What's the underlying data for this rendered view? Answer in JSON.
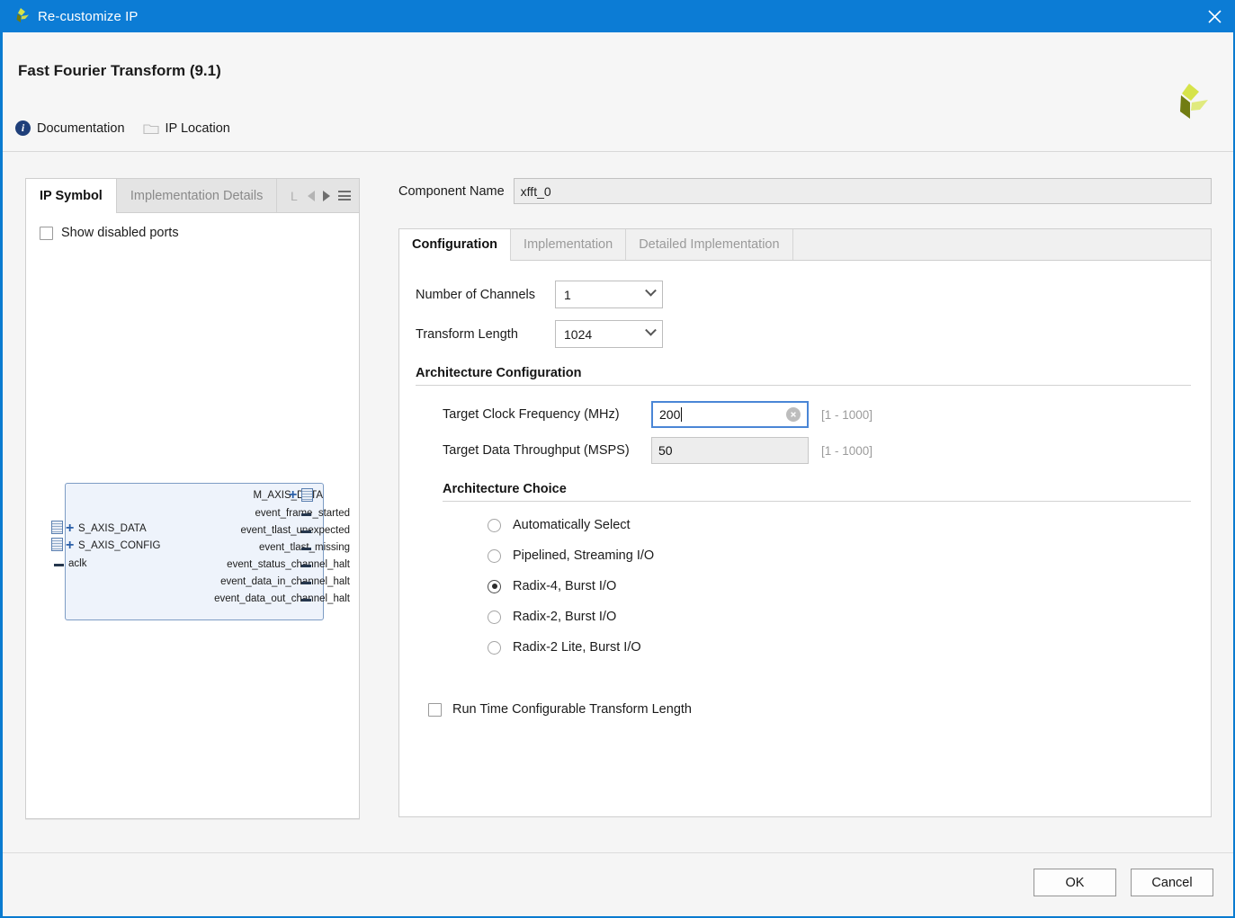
{
  "window": {
    "title": "Re-customize IP",
    "logo_icon": "xilinx-logo-icon",
    "close_icon": "close-icon",
    "accent_color": "#0c7cd5"
  },
  "header": {
    "title": "Fast Fourier Transform (9.1)",
    "brand_logo_icon": "xilinx-logo-icon",
    "links": [
      {
        "label": "Documentation",
        "icon": "info-icon"
      },
      {
        "label": "IP Location",
        "icon": "folder-icon"
      }
    ]
  },
  "left_panel": {
    "tabs": [
      {
        "label": "IP Symbol",
        "active": true
      },
      {
        "label": "Implementation Details",
        "active": false
      }
    ],
    "clipped_tab_label": "L",
    "nav": {
      "prev_icon": "triangle-left-icon",
      "next_icon": "triangle-right-icon",
      "menu_icon": "hamburger-menu-icon"
    },
    "show_disabled_ports": {
      "label": "Show disabled ports",
      "checked": false
    },
    "symbol": {
      "output_ports": [
        "M_AXIS_DATA",
        "event_frame_started",
        "event_tlast_unexpected",
        "event_tlast_missing",
        "event_status_channel_halt",
        "event_data_in_channel_halt",
        "event_data_out_channel_halt"
      ],
      "input_bus_ports": [
        "S_AXIS_DATA",
        "S_AXIS_CONFIG"
      ],
      "input_pin_ports": [
        "aclk"
      ]
    }
  },
  "right_panel": {
    "component_name": {
      "label": "Component Name",
      "value": "xfft_0",
      "enabled": false
    },
    "tabs": [
      {
        "label": "Configuration",
        "active": true
      },
      {
        "label": "Implementation",
        "active": false
      },
      {
        "label": "Detailed Implementation",
        "active": false
      }
    ],
    "fields": {
      "number_of_channels": {
        "label": "Number of Channels",
        "value": "1"
      },
      "transform_length": {
        "label": "Transform Length",
        "value": "1024"
      }
    },
    "architecture_configuration": {
      "heading": "Architecture Configuration",
      "target_clock_frequency": {
        "label": "Target Clock Frequency (MHz)",
        "value": "200",
        "hint": "[1 - 1000]",
        "focused": true,
        "clear_icon": "clear-field-icon"
      },
      "target_data_throughput": {
        "label": "Target Data Throughput (MSPS)",
        "value": "50",
        "hint": "[1 - 1000]",
        "enabled": false
      }
    },
    "architecture_choice": {
      "heading": "Architecture Choice",
      "selected": "Radix-4, Burst I/O",
      "options": [
        "Automatically Select",
        "Pipelined, Streaming I/O",
        "Radix-4, Burst I/O",
        "Radix-2, Burst I/O",
        "Radix-2 Lite, Burst I/O"
      ]
    },
    "run_time_configurable": {
      "label": "Run Time Configurable Transform Length",
      "checked": false
    }
  },
  "footer": {
    "ok_label": "OK",
    "cancel_label": "Cancel"
  }
}
